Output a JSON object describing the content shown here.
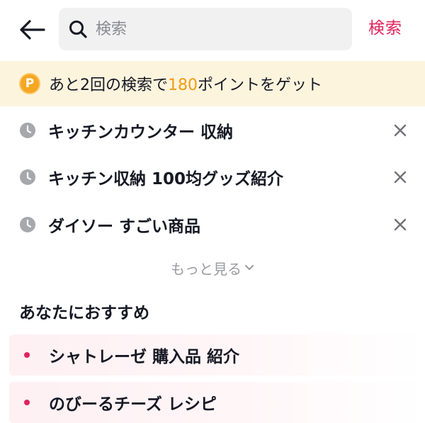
{
  "header": {
    "search_placeholder": "検索",
    "search_button_label": "検索"
  },
  "points_banner": {
    "prefix": "あと2回の検索で",
    "points": "180",
    "suffix": "ポイントをゲット",
    "icon_letter": "P"
  },
  "history": [
    {
      "label": "キッチンカウンター 収納"
    },
    {
      "label": "キッチン収納 100均グッズ紹介"
    },
    {
      "label": "ダイソー すごい商品"
    }
  ],
  "more_label": "もっと見る",
  "recommend": {
    "title": "あなたにおすすめ",
    "items": [
      {
        "label": "シャトレーゼ 購入品 紹介"
      },
      {
        "label": "のびーるチーズ レシピ"
      }
    ]
  },
  "colors": {
    "accent": "#e0245e",
    "points": "#f29c12",
    "banner_bg": "#fdf4de"
  }
}
